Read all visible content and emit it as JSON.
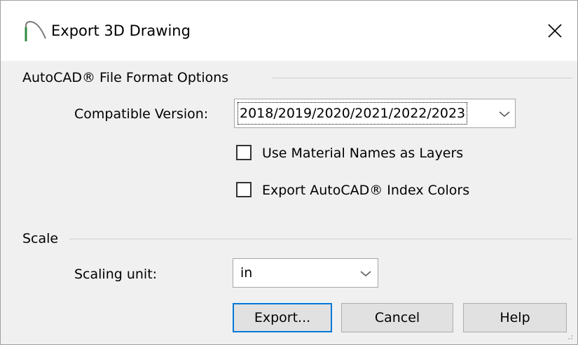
{
  "window": {
    "title": "Export 3D Drawing",
    "close_icon": "close-icon",
    "app_icon": "chief-architect-arc-icon"
  },
  "autocad_group": {
    "label": "AutoCAD® File Format Options",
    "version_label": "Compatible Version:",
    "version_value": "2018/2019/2020/2021/2022/2023",
    "use_material_names_label": "Use Material Names as Layers",
    "use_material_names_checked": false,
    "export_index_colors_label": "Export AutoCAD® Index Colors",
    "export_index_colors_checked": false
  },
  "scale_group": {
    "label": "Scale",
    "scaling_unit_label": "Scaling unit:",
    "scaling_unit_value": "in"
  },
  "buttons": {
    "export": "Export...",
    "cancel": "Cancel",
    "help": "Help"
  },
  "colors": {
    "accent": "#0078d7",
    "dialog_bg": "#f0f0f0"
  }
}
